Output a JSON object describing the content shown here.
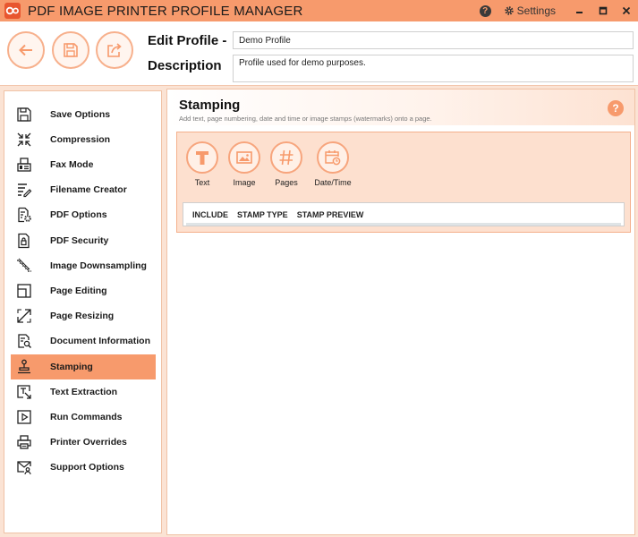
{
  "app": {
    "title": "PDF IMAGE PRINTER PROFILE MANAGER",
    "help_glyph": "?",
    "settings_label": "Settings"
  },
  "header": {
    "edit_profile_label": "Edit Profile -",
    "description_label": "Description",
    "profile_name": "Demo Profile",
    "description": "Profile used for demo purposes."
  },
  "sidebar": {
    "items": [
      {
        "label": "Save Options",
        "icon": "floppy-icon"
      },
      {
        "label": "Compression",
        "icon": "compress-arrows-icon"
      },
      {
        "label": "Fax Mode",
        "icon": "fax-icon"
      },
      {
        "label": "Filename Creator",
        "icon": "filename-pencil-icon"
      },
      {
        "label": "PDF Options",
        "icon": "pdf-gear-icon"
      },
      {
        "label": "PDF Security",
        "icon": "pdf-lock-icon"
      },
      {
        "label": "Image Downsampling",
        "icon": "downsample-stairs-icon"
      },
      {
        "label": "Page Editing",
        "icon": "page-edit-icon"
      },
      {
        "label": "Page Resizing",
        "icon": "resize-arrows-icon"
      },
      {
        "label": "Document Information",
        "icon": "document-search-icon"
      },
      {
        "label": "Stamping",
        "icon": "stamp-icon",
        "active": true
      },
      {
        "label": "Text Extraction",
        "icon": "text-extract-icon"
      },
      {
        "label": "Run Commands",
        "icon": "run-play-icon"
      },
      {
        "label": "Printer Overrides",
        "icon": "printer-icon"
      },
      {
        "label": "Support Options",
        "icon": "support-envelope-icon"
      }
    ]
  },
  "content": {
    "title": "Stamping",
    "subtitle": "Add text, page numbering, date and time or image stamps (watermarks) onto a page.",
    "help_glyph": "?",
    "stamp_buttons": [
      {
        "label": "Text",
        "icon": "text-T-icon"
      },
      {
        "label": "Image",
        "icon": "image-icon"
      },
      {
        "label": "Pages",
        "icon": "hash-icon"
      },
      {
        "label": "Date/Time",
        "icon": "calendar-clock-icon"
      }
    ],
    "table_columns": [
      "INCLUDE",
      "STAMP TYPE",
      "STAMP PREVIEW"
    ]
  },
  "colors": {
    "accent": "#f79a6c",
    "panel": "#fde0cf",
    "background": "#fbe3d4"
  }
}
